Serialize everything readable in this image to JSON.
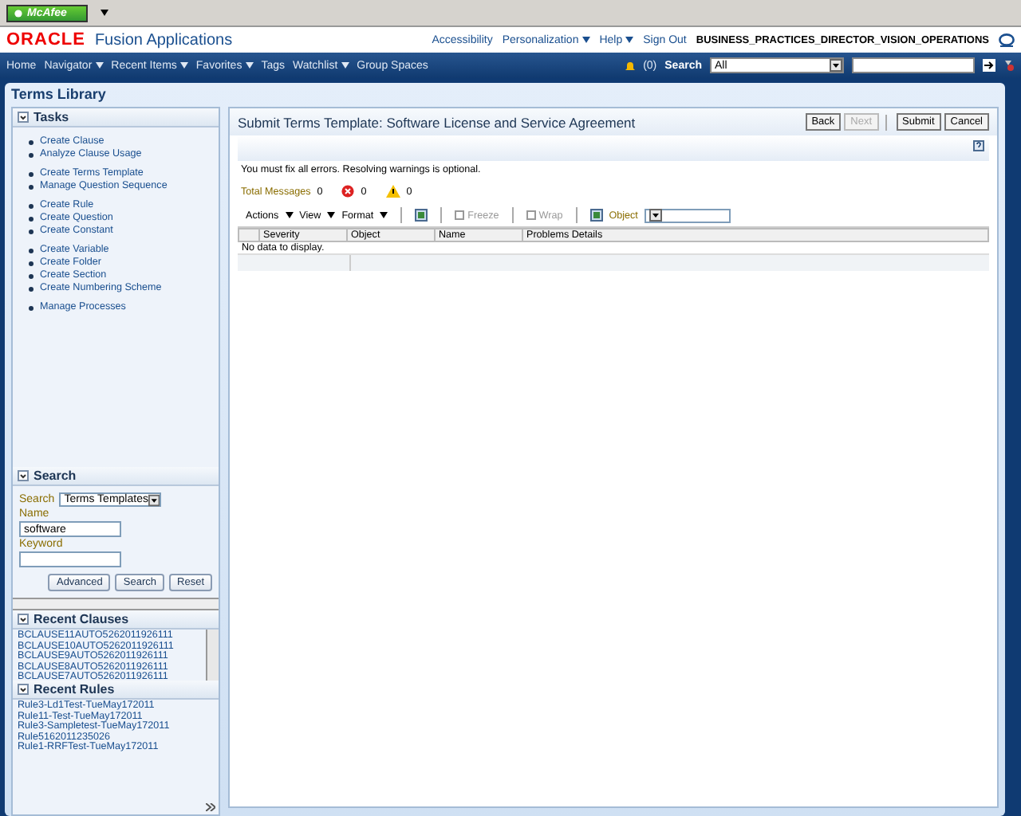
{
  "browser_toolbar": {
    "addon_label": "McAfee"
  },
  "header": {
    "logo": "ORACLE",
    "app_title": "Fusion Applications",
    "links": [
      {
        "label": "Accessibility",
        "has_menu": false
      },
      {
        "label": "Personalization",
        "has_menu": true
      },
      {
        "label": "Help",
        "has_menu": true
      },
      {
        "label": "Sign Out",
        "has_menu": false
      }
    ],
    "user": "BUSINESS_PRACTICES_DIRECTOR_VISION_OPERATIONS"
  },
  "nav": {
    "items": [
      {
        "label": "Home",
        "has_menu": false
      },
      {
        "label": "Navigator",
        "has_menu": true
      },
      {
        "label": "Recent Items",
        "has_menu": true
      },
      {
        "label": "Favorites",
        "has_menu": true
      },
      {
        "label": "Tags",
        "has_menu": false
      },
      {
        "label": "Watchlist",
        "has_menu": true
      },
      {
        "label": "Group Spaces",
        "has_menu": false
      }
    ],
    "notifications": "(0)",
    "search_label": "Search",
    "search_scope": "All"
  },
  "page_title": "Terms Library",
  "tasks": {
    "title": "Tasks",
    "groups": [
      [
        "Create Clause",
        "Analyze Clause Usage"
      ],
      [
        "Create Terms Template",
        "Manage Question Sequence"
      ],
      [
        "Create Rule",
        "Create Question",
        "Create Constant"
      ],
      [
        "Create Variable",
        "Create Folder",
        "Create Section",
        "Create Numbering Scheme"
      ],
      [
        "Manage Processes"
      ]
    ]
  },
  "search_panel": {
    "title": "Search",
    "search_label": "Search",
    "search_value": "Terms Templates",
    "name_label": "Name",
    "name_value": "software",
    "keyword_label": "Keyword",
    "buttons": [
      "Advanced",
      "Search",
      "Reset"
    ]
  },
  "recent_clauses": {
    "title": "Recent Clauses",
    "items": [
      "BCLAUSE11AUTO5262011926111",
      "BCLAUSE10AUTO5262011926111",
      "BCLAUSE9AUTO5262011926111",
      "BCLAUSE8AUTO5262011926111",
      "BCLAUSE7AUTO5262011926111"
    ]
  },
  "recent_rules": {
    "title": "Recent Rules",
    "items": [
      "Rule3-Ld1Test-TueMay172011",
      "Rule11-Test-TueMay172011",
      "Rule3-Sampletest-TueMay172011",
      "Rule5162011235026",
      "Rule1-RRFTest-TueMay172011"
    ]
  },
  "main": {
    "title": "Submit Terms Template: Software License and Service Agreement",
    "buttons": [
      {
        "label": "Back",
        "disabled": false
      },
      {
        "label": "Next",
        "disabled": true
      },
      {
        "label": "Submit",
        "disabled": false
      },
      {
        "label": "Cancel",
        "disabled": false
      }
    ],
    "instruction": "You must fix all errors. Resolving warnings is optional.",
    "total_label": "Total Messages",
    "total_value": "0",
    "errors": "0",
    "warnings": "0",
    "toolbar": {
      "menus": [
        "Actions",
        "View",
        "Format"
      ],
      "tools": [
        {
          "label": "Freeze",
          "disabled": true
        },
        {
          "label": "Wrap",
          "disabled": true
        }
      ],
      "object_label": "Object"
    },
    "table": {
      "columns": [
        "Severity",
        "Object",
        "Name",
        "Problems Details"
      ],
      "empty_text": "No data to display."
    }
  }
}
